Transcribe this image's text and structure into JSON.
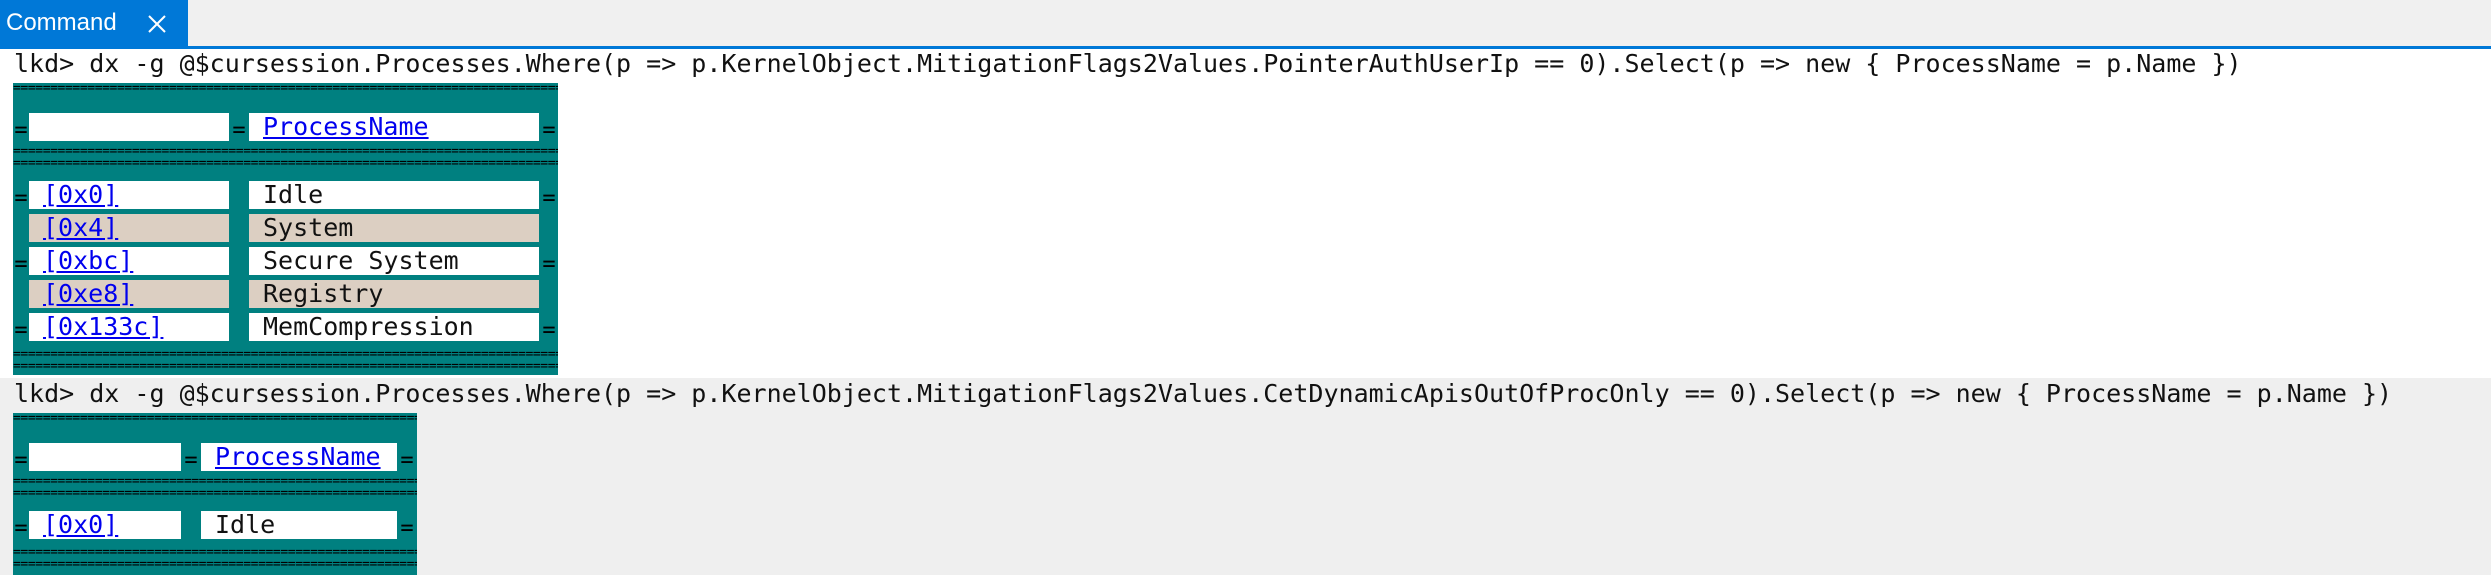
{
  "tab": {
    "label": "Command",
    "close_icon": "close-icon"
  },
  "commands": [
    "lkd> dx -g @$cursession.Processes.Where(p => p.KernelObject.MitigationFlags2Values.PointerAuthUserIp == 0).Select(p => new { ProcessName = p.Name })",
    "lkd> dx -g @$cursession.Processes.Where(p => p.KernelObject.MitigationFlags2Values.CetDynamicApisOutOfProcOnly == 0).Select(p => new { ProcessName = p.Name })"
  ],
  "grid1": {
    "header": "ProcessName",
    "rows": [
      {
        "index": "[0x0]",
        "name": "Idle"
      },
      {
        "index": "[0x4]",
        "name": "System"
      },
      {
        "index": "[0xbc]",
        "name": "Secure System"
      },
      {
        "index": "[0xe8]",
        "name": "Registry"
      },
      {
        "index": "[0x133c]",
        "name": "MemCompression"
      }
    ]
  },
  "grid2": {
    "header": "ProcessName",
    "rows": [
      {
        "index": "[0x0]",
        "name": "Idle"
      }
    ]
  },
  "colors": {
    "accent": "#0078d7",
    "grid_border": "#008080",
    "alt_row": "#dccfc2",
    "link": "#0000ee",
    "output_bg": "#efefef"
  },
  "separator_char": "="
}
